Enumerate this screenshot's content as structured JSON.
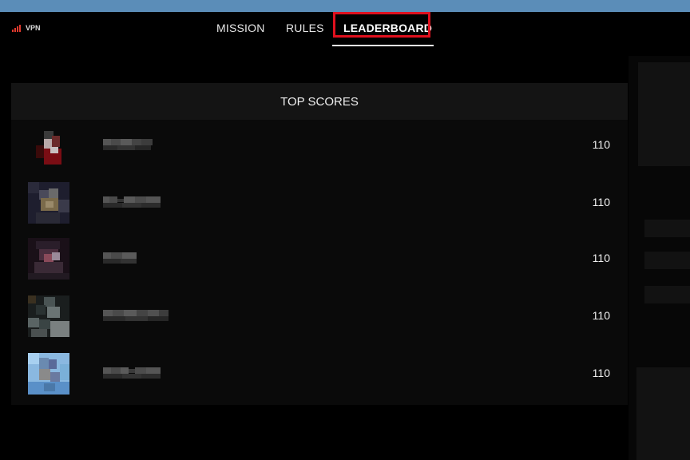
{
  "status": {
    "vpn_label": "VPN",
    "signal_icon": "signal-bars-icon",
    "signal_color": "#e03a2e"
  },
  "nav": {
    "tabs": [
      {
        "label": "MISSION",
        "active": false
      },
      {
        "label": "RULES",
        "active": false
      },
      {
        "label": "LEADERBOARD",
        "active": true
      }
    ],
    "highlight_color": "#e0101e"
  },
  "leaderboard": {
    "title": "TOP SCORES",
    "entries": [
      {
        "score": "110"
      },
      {
        "score": "110"
      },
      {
        "score": "110"
      },
      {
        "score": "110"
      },
      {
        "score": "110"
      }
    ]
  },
  "colors": {
    "topbar": "#5b8db8",
    "background": "#000000",
    "panel": "#0a0a0a",
    "panel_header": "#141414"
  }
}
